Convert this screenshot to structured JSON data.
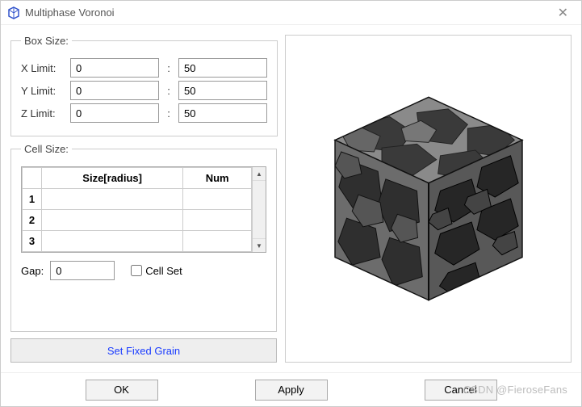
{
  "window": {
    "title": "Multiphase Voronoi"
  },
  "boxSize": {
    "legend": "Box Size:",
    "x": {
      "label": "X Limit:",
      "min": "0",
      "max": "50"
    },
    "y": {
      "label": "Y Limit:",
      "min": "0",
      "max": "50"
    },
    "z": {
      "label": "Z Limit:",
      "min": "0",
      "max": "50"
    },
    "sep": ":"
  },
  "cellSize": {
    "legend": "Cell Size:",
    "headers": {
      "col1": "Size[radius]",
      "col2": "Num"
    },
    "rows": [
      {
        "num": "1",
        "size": "",
        "count": ""
      },
      {
        "num": "2",
        "size": "",
        "count": ""
      },
      {
        "num": "3",
        "size": "",
        "count": ""
      }
    ],
    "gap": {
      "label": "Gap:",
      "value": "0"
    },
    "cellSetLabel": "Cell Set"
  },
  "setFixedLabel": "Set Fixed Grain",
  "footer": {
    "ok": "OK",
    "apply": "Apply",
    "cancel": "Cancel"
  },
  "watermark": "CSDN @FieroseFans"
}
